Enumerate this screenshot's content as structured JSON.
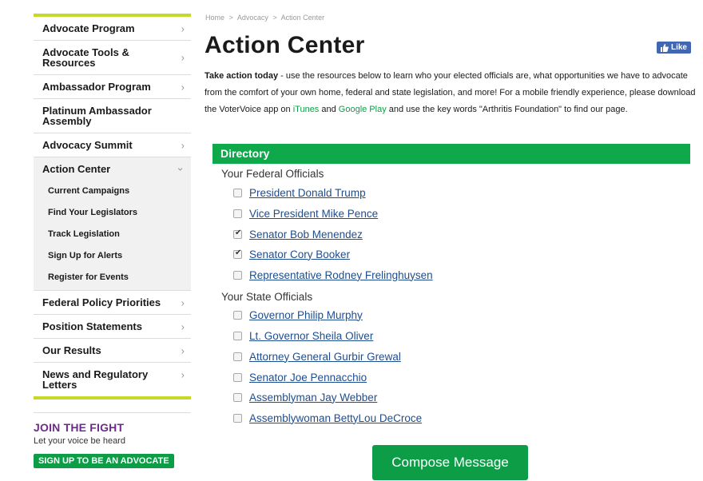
{
  "sidebar": {
    "items": [
      {
        "label": "Advocate Program",
        "chevron": "›"
      },
      {
        "label": "Advocate Tools & Resources",
        "chevron": "›"
      },
      {
        "label": "Ambassador Program",
        "chevron": "›"
      },
      {
        "label": "Platinum Ambassador Assembly",
        "chevron": ""
      },
      {
        "label": "Advocacy Summit",
        "chevron": "›"
      },
      {
        "label": "Action Center",
        "chevron": "⌄"
      },
      {
        "label": "Federal Policy Priorities",
        "chevron": "›"
      },
      {
        "label": "Position Statements",
        "chevron": "›"
      },
      {
        "label": "Our Results",
        "chevron": "›"
      },
      {
        "label": "News and Regulatory Letters",
        "chevron": "›"
      }
    ],
    "subitems": [
      "Current Campaigns",
      "Find Your Legislators",
      "Track Legislation",
      "Sign Up for Alerts",
      "Register for Events"
    ],
    "join_title": "JOIN THE FIGHT",
    "join_sub": "Let your voice be heard",
    "join_button": "SIGN UP TO BE AN ADVOCATE"
  },
  "breadcrumb": {
    "home": "Home",
    "sep": ">",
    "advocacy": "Advocacy",
    "current": "Action Center"
  },
  "page_title": "Action Center",
  "like_label": "Like",
  "intro": {
    "lead": "Take action today",
    "text1": " - use the resources below to learn who your elected officials are, what opportunities we have to advocate from the comfort of your own home, federal and state legislation, and more! For a mobile friendly experience, please download the VoterVoice app on ",
    "itunes": "iTunes",
    "and": " and ",
    "google": "Google Play",
    "text2": " and use the key words \"Arthritis Foundation\" to find our page."
  },
  "directory": {
    "header": "Directory",
    "federal_label": "Your Federal Officials",
    "state_label": "Your State Officials",
    "federal": [
      {
        "name": "President Donald Trump",
        "checked": false
      },
      {
        "name": "Vice President Mike Pence",
        "checked": false
      },
      {
        "name": "Senator Bob Menendez",
        "checked": true
      },
      {
        "name": "Senator Cory Booker",
        "checked": true
      },
      {
        "name": "Representative Rodney Frelinghuysen",
        "checked": false
      }
    ],
    "state": [
      {
        "name": "Governor Philip Murphy",
        "checked": false
      },
      {
        "name": "Lt. Governor Sheila Oliver",
        "checked": false
      },
      {
        "name": "Attorney General Gurbir Grewal",
        "checked": false
      },
      {
        "name": "Senator Joe Pennacchio",
        "checked": false
      },
      {
        "name": "Assemblyman Jay Webber",
        "checked": false
      },
      {
        "name": "Assemblywoman BettyLou DeCroce",
        "checked": false
      }
    ]
  },
  "compose_button": "Compose Message",
  "colors": {
    "accent_green": "#0e9d47",
    "lime_rule": "#c6d92a",
    "purple": "#6d2b8b",
    "facebook": "#4267b2"
  }
}
